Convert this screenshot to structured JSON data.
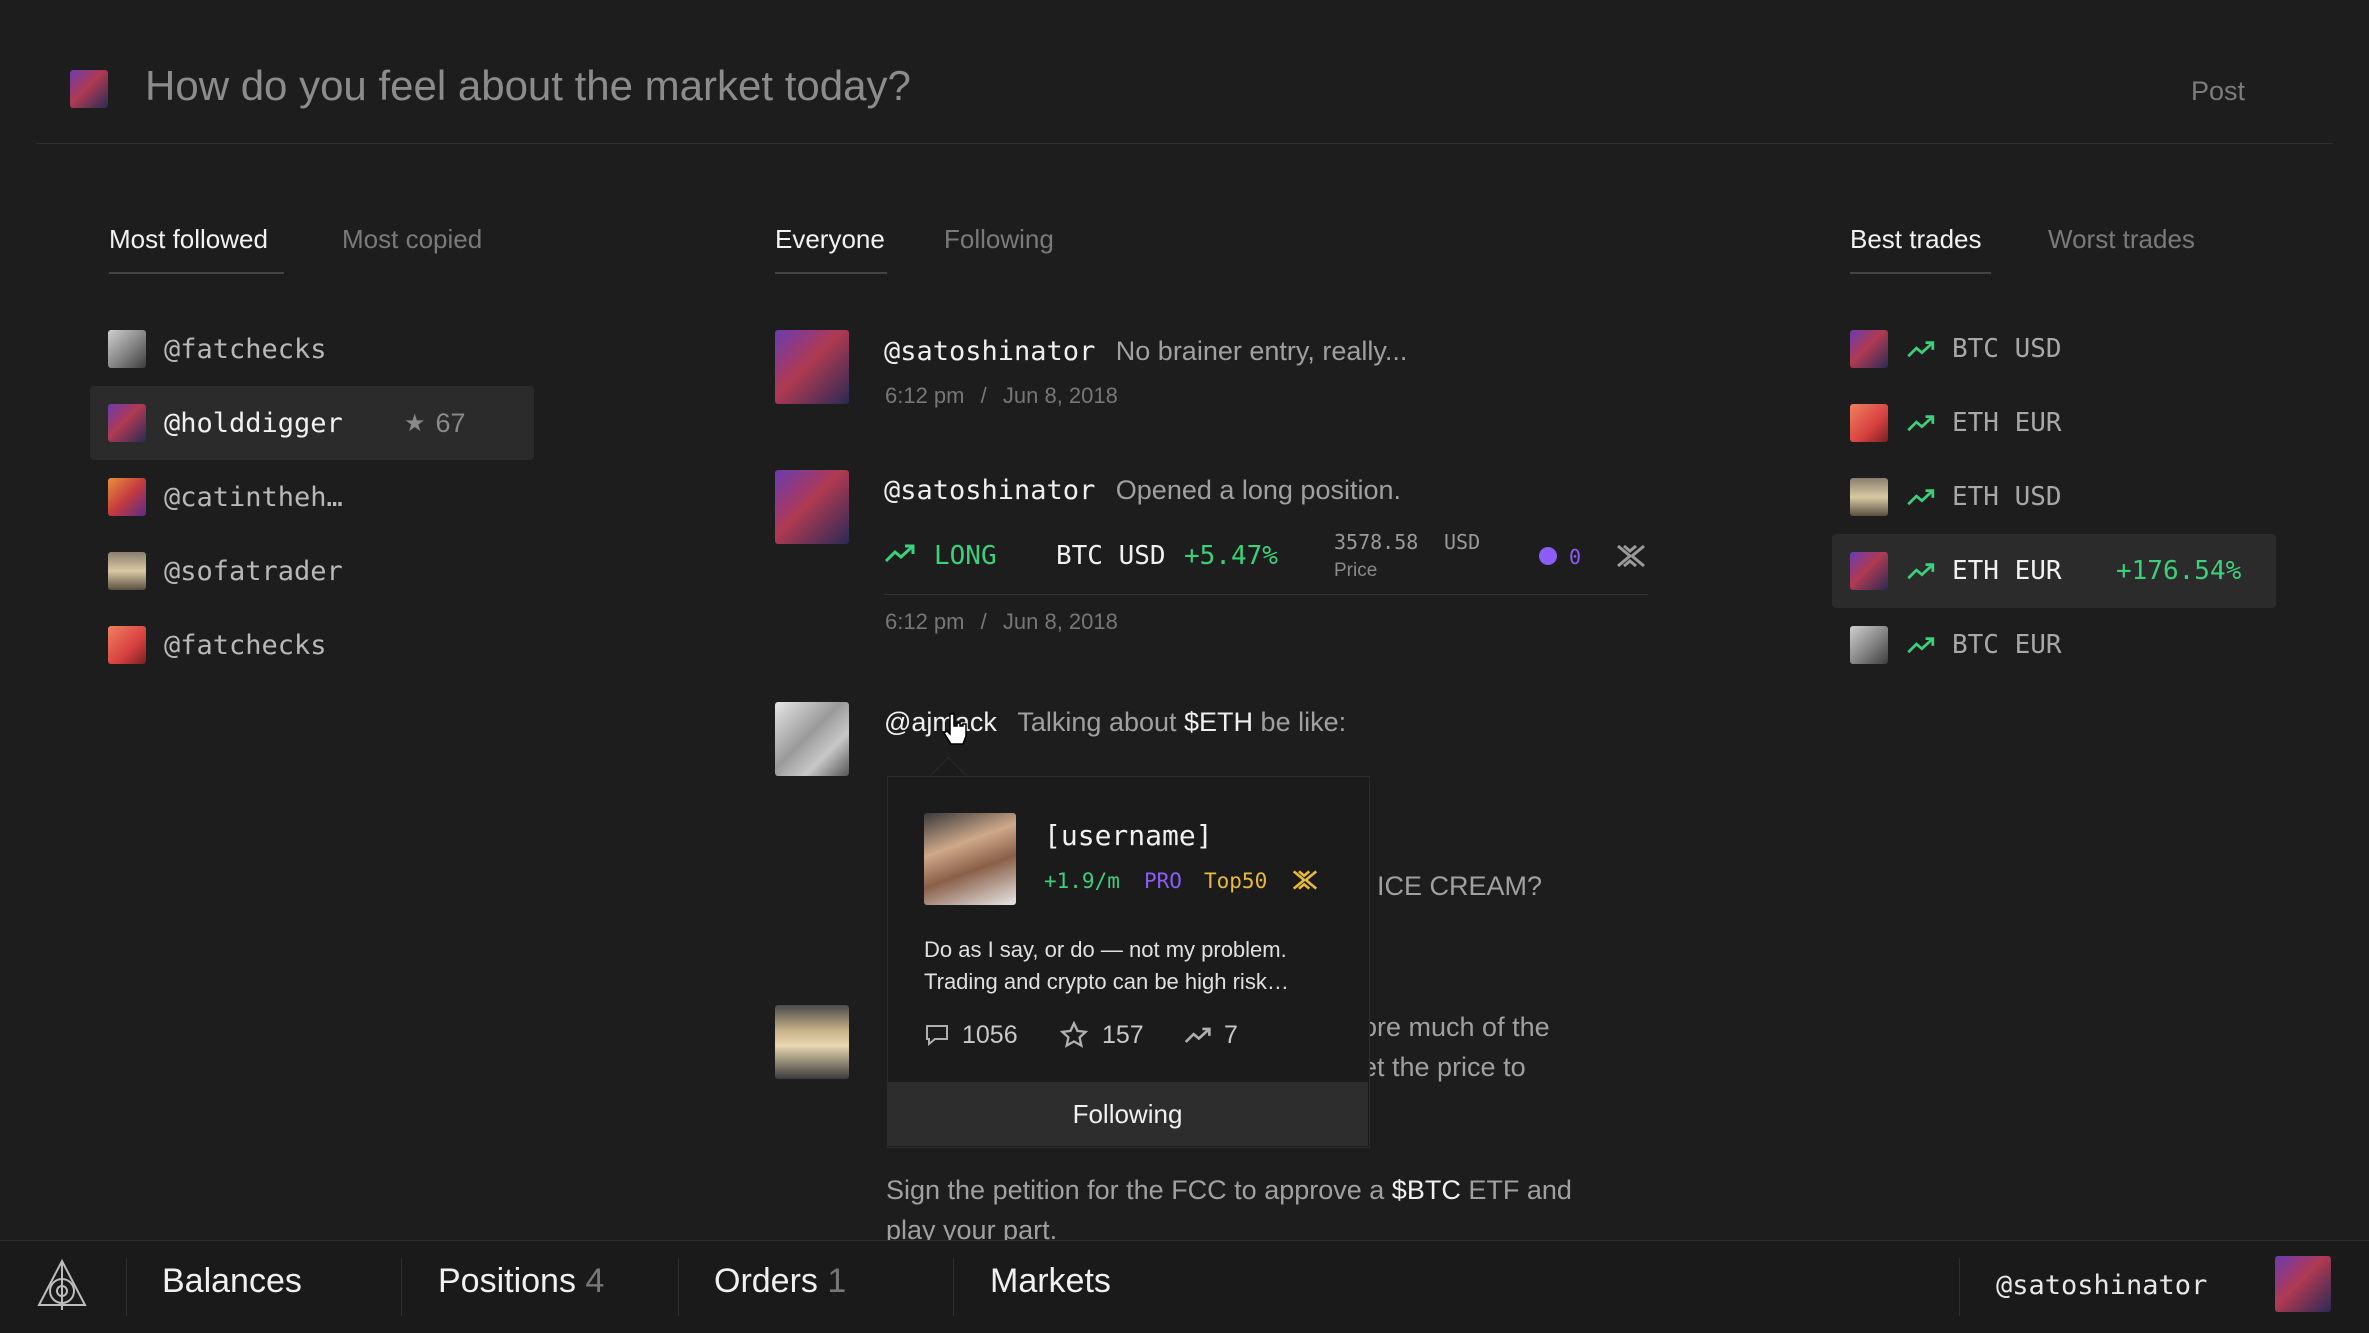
{
  "composer": {
    "placeholder": "How do you feel about the market today?",
    "post_label": "Post"
  },
  "left": {
    "tabs": [
      "Most followed",
      "Most copied"
    ],
    "active_tab": "Most followed",
    "users": [
      {
        "name": "@fatchecks"
      },
      {
        "name": "@holddigger",
        "stars": "67",
        "selected": true
      },
      {
        "name": "@catintheh…"
      },
      {
        "name": "@sofatrader"
      },
      {
        "name": "@fatchecks"
      }
    ]
  },
  "feed": {
    "tabs": [
      "Everyone",
      "Following"
    ],
    "posts": [
      {
        "user": "@satoshinator",
        "text": "No brainer entry, really...",
        "time": "6:12 pm",
        "date": "Jun 8, 2018"
      },
      {
        "user": "@satoshinator",
        "text": "Opened a long position.",
        "position": {
          "side": "LONG",
          "pair": "BTC USD",
          "change": "+5.47%",
          "price": "3578.58",
          "currency": "USD",
          "price_label": "Price",
          "count": "0"
        },
        "time": "6:12 pm",
        "date": "Jun 8, 2018"
      },
      {
        "user": "@ajmack",
        "text_pre": "Talking about ",
        "ticker": "$ETH",
        "text_post": " be like:"
      },
      {
        "partial_text": "ICE CREAM?"
      },
      {
        "partial_line1": "ore much of the",
        "partial_line2": "et the price to"
      },
      {
        "text_pre": "Sign the petition for the FCC to approve a ",
        "ticker": "$BTC",
        "text_post": " ETF and",
        "line2": "play your part."
      }
    ],
    "date_separator": "/"
  },
  "popover": {
    "username": "[username]",
    "rate": "+1.9/m",
    "badge_pro": "PRO",
    "badge_top": "Top50",
    "bio_line1": "Do as I say, or do — not my problem.",
    "bio_line2": "Trading and crypto can be high risk…",
    "comments": "1056",
    "stars": "157",
    "trades": "7",
    "follow_label": "Following"
  },
  "right": {
    "tabs": [
      "Best trades",
      "Worst trades"
    ],
    "trades": [
      {
        "pair": "BTC USD"
      },
      {
        "pair": "ETH EUR"
      },
      {
        "pair": "ETH USD"
      },
      {
        "pair": "ETH EUR",
        "change": "+176.54%",
        "selected": true
      },
      {
        "pair": "BTC EUR"
      }
    ]
  },
  "bottom": {
    "nav": [
      {
        "label": "Balances"
      },
      {
        "label": "Positions",
        "count": "4"
      },
      {
        "label": "Orders",
        "count": "1"
      },
      {
        "label": "Markets"
      }
    ],
    "current_user": "@satoshinator"
  },
  "colors": {
    "bg": "#1d1d1d",
    "green": "#3ecf7a",
    "purple": "#8b5cf6",
    "gold": "#e8b93c"
  }
}
